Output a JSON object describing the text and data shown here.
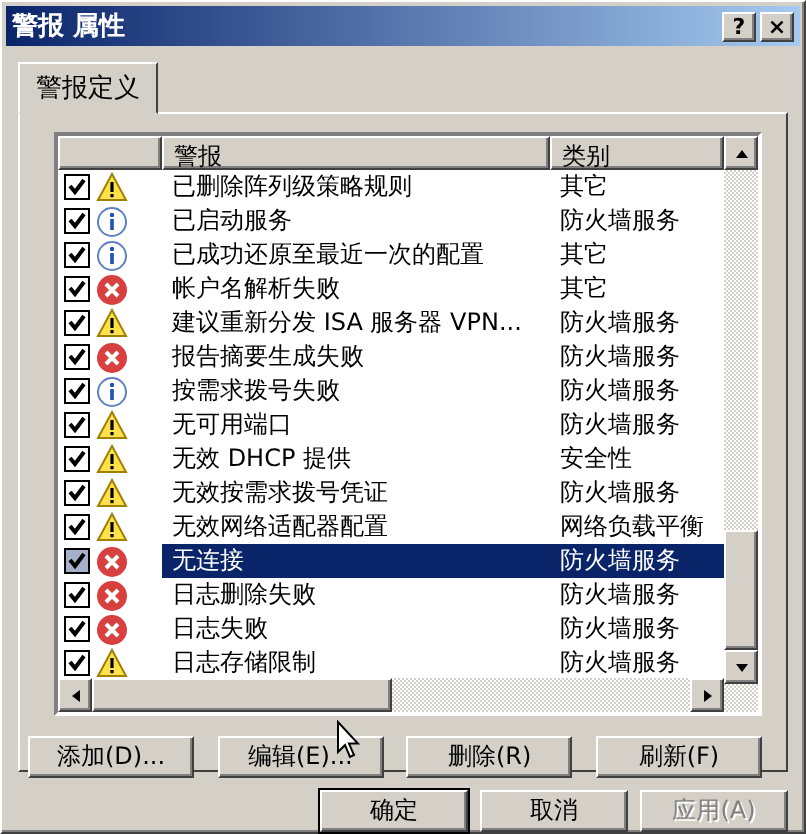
{
  "window": {
    "title": "警报 属性",
    "buttons": [
      {
        "label": "?"
      },
      {
        "label": "×"
      }
    ]
  },
  "tabs": [
    {
      "label": "警报定义",
      "selected": true
    }
  ],
  "table": {
    "columns": [
      "警报",
      "类别"
    ],
    "rows": [
      {
        "checked": true,
        "kind": "warning",
        "name": "已删除阵列级策略规则",
        "category": "其它",
        "selected": false
      },
      {
        "checked": true,
        "kind": "info",
        "name": "已启动服务",
        "category": "防火墙服务",
        "selected": false
      },
      {
        "checked": true,
        "kind": "info",
        "name": "已成功还原至最近一次的配置",
        "category": "其它",
        "selected": false
      },
      {
        "checked": true,
        "kind": "error",
        "name": "帐户名解析失败",
        "category": "其它",
        "selected": false
      },
      {
        "checked": true,
        "kind": "warning",
        "name": "建议重新分发 ISA 服务器 VPN...",
        "category": "防火墙服务",
        "selected": false
      },
      {
        "checked": true,
        "kind": "error",
        "name": "报告摘要生成失败",
        "category": "防火墙服务",
        "selected": false
      },
      {
        "checked": true,
        "kind": "info",
        "name": "按需求拨号失败",
        "category": "防火墙服务",
        "selected": false
      },
      {
        "checked": true,
        "kind": "warning",
        "name": "无可用端口",
        "category": "防火墙服务",
        "selected": false
      },
      {
        "checked": true,
        "kind": "warning",
        "name": "无效 DHCP 提供",
        "category": "安全性",
        "selected": false
      },
      {
        "checked": true,
        "kind": "warning",
        "name": "无效按需求拨号凭证",
        "category": "防火墙服务",
        "selected": false
      },
      {
        "checked": true,
        "kind": "warning",
        "name": "无效网络适配器配置",
        "category": "网络负载平衡",
        "selected": false
      },
      {
        "checked": true,
        "kind": "error",
        "name": "无连接",
        "category": "防火墙服务",
        "selected": true
      },
      {
        "checked": true,
        "kind": "error",
        "name": "日志删除失败",
        "category": "防火墙服务",
        "selected": false
      },
      {
        "checked": true,
        "kind": "error",
        "name": "日志失败",
        "category": "防火墙服务",
        "selected": false
      },
      {
        "checked": true,
        "kind": "warning",
        "name": "日志存储限制",
        "category": "防火墙服务",
        "selected": false
      }
    ]
  },
  "actions": [
    {
      "label": "添加(D)...",
      "disabled": false
    },
    {
      "label": "编辑(E)...",
      "disabled": false
    },
    {
      "label": "删除(R)",
      "disabled": false
    },
    {
      "label": "刷新(F)",
      "disabled": false
    }
  ],
  "dialog_buttons": [
    {
      "label": "确定",
      "disabled": false,
      "default": true
    },
    {
      "label": "取消",
      "disabled": false,
      "default": false
    },
    {
      "label": "应用(A)",
      "disabled": true,
      "default": false
    }
  ]
}
